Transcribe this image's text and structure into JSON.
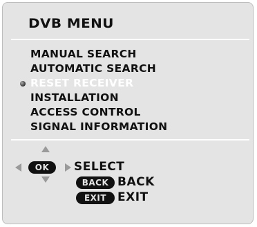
{
  "menu": {
    "title": "DVB MENU",
    "items": [
      {
        "label": "MANUAL SEARCH",
        "selected": false
      },
      {
        "label": "AUTOMATIC SEARCH",
        "selected": false
      },
      {
        "label": "RESET RECEIVER",
        "selected": true
      },
      {
        "label": "INSTALLATION",
        "selected": false
      },
      {
        "label": "ACCESS CONTROL",
        "selected": false
      },
      {
        "label": "SIGNAL INFORMATION",
        "selected": false
      }
    ]
  },
  "nav": {
    "ok_key": "OK",
    "select_label": "SELECT",
    "back_key": "BACK",
    "back_label": "BACK",
    "exit_key": "EXIT",
    "exit_label": "EXIT"
  },
  "colors": {
    "background": "#e4e4e4",
    "text": "#111111",
    "selected_text": "#ffffff",
    "arrow": "#9a9a9a"
  }
}
